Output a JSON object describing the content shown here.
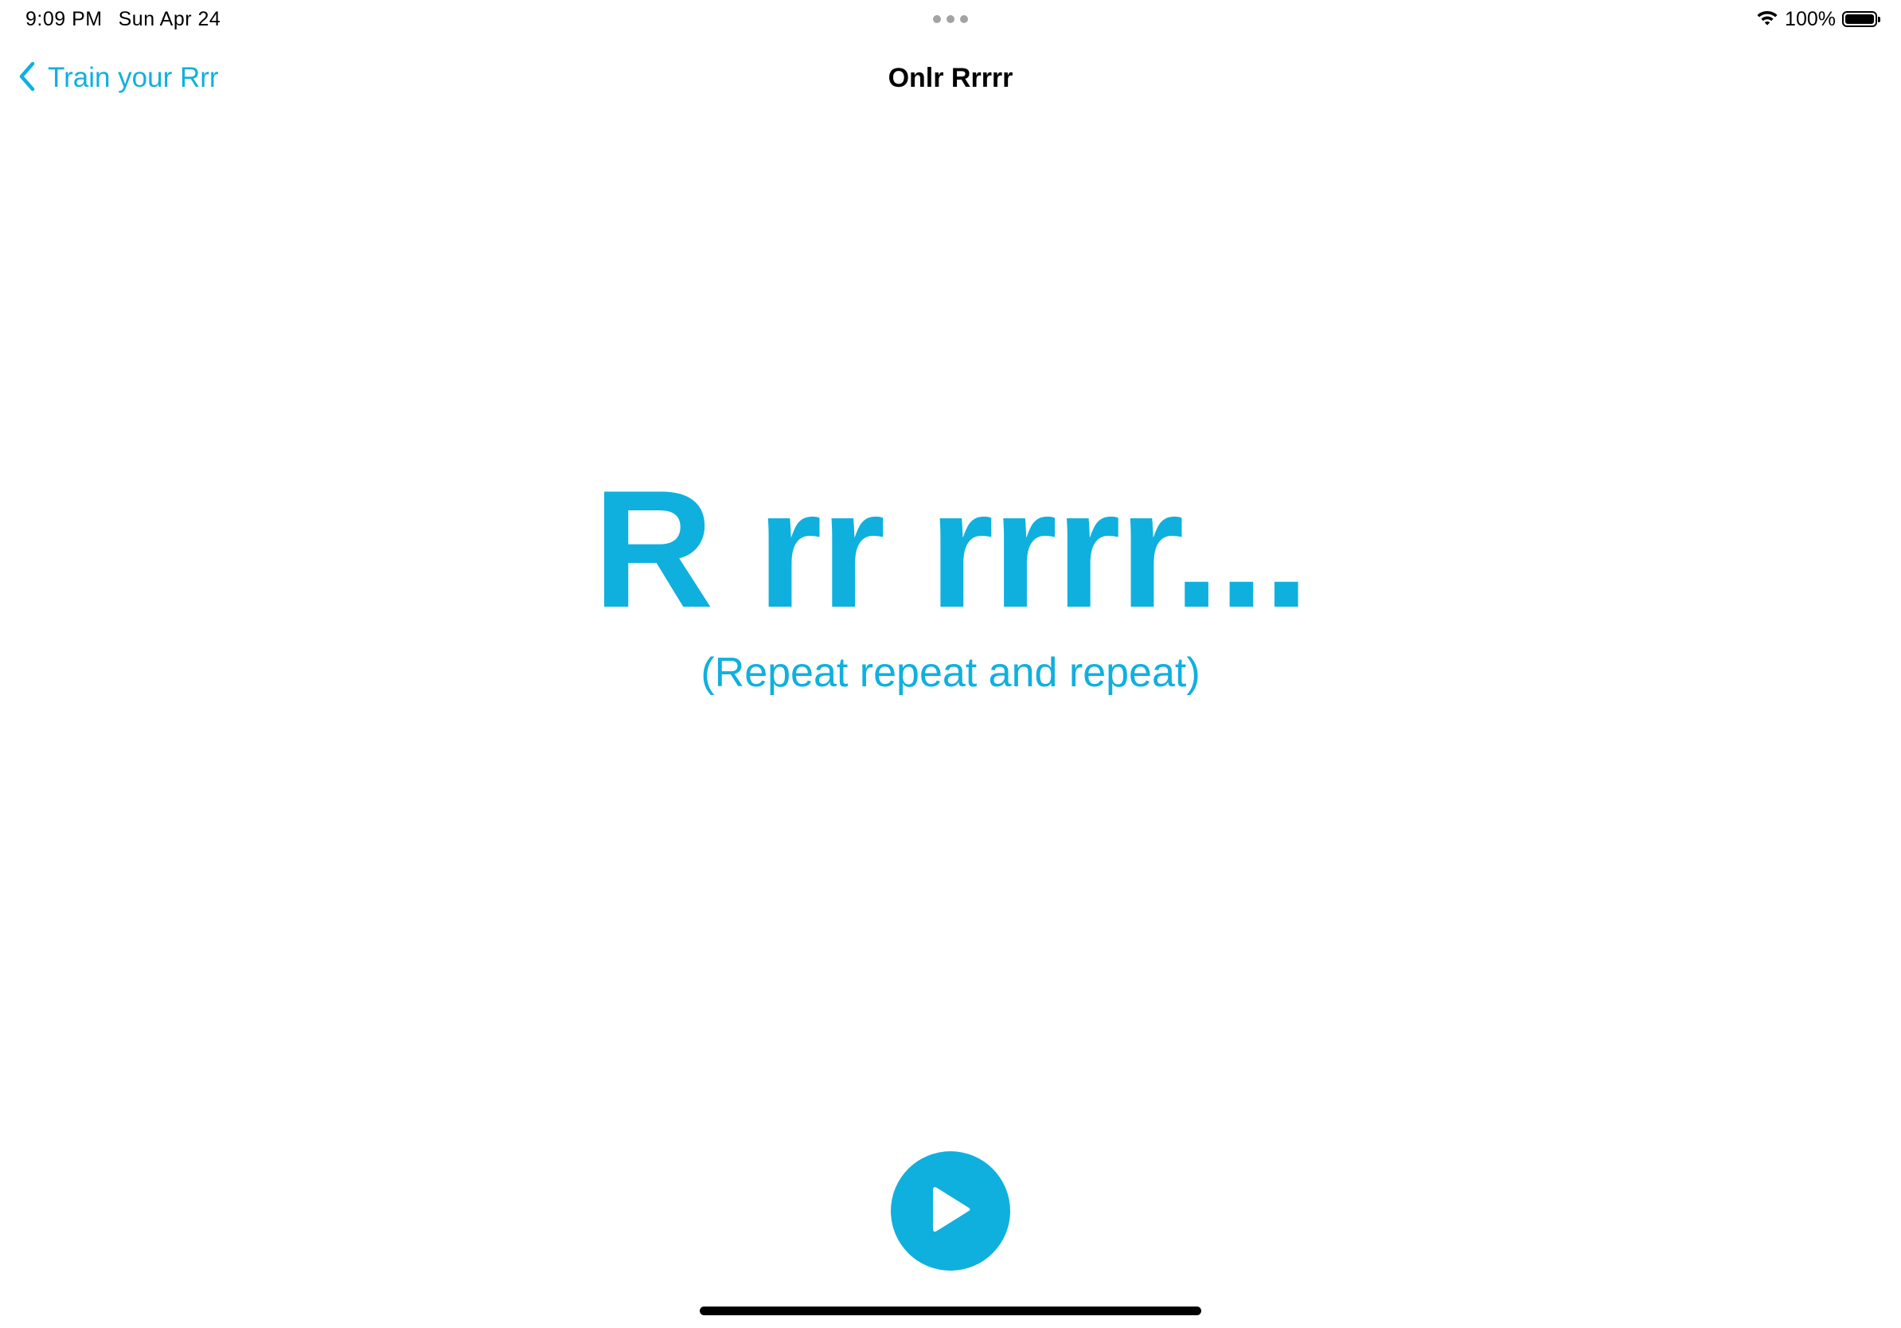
{
  "status_bar": {
    "time": "9:09 PM",
    "date": "Sun Apr 24",
    "battery_percent": "100%",
    "battery_level": 1.0,
    "icons": [
      "wifi-icon",
      "battery-icon",
      "multitask-dots-icon"
    ]
  },
  "nav": {
    "back_label": "Train your Rrr",
    "back_icon": "chevron-left-icon",
    "title": "Onlr Rrrrr"
  },
  "main": {
    "headline": "R rr rrrr...",
    "subline": "(Repeat repeat and repeat)"
  },
  "controls": {
    "play_icon": "play-icon"
  },
  "colors": {
    "accent": "#0fb0de",
    "background": "#ffffff",
    "text": "#000000",
    "dots": "#a3a3a3"
  }
}
